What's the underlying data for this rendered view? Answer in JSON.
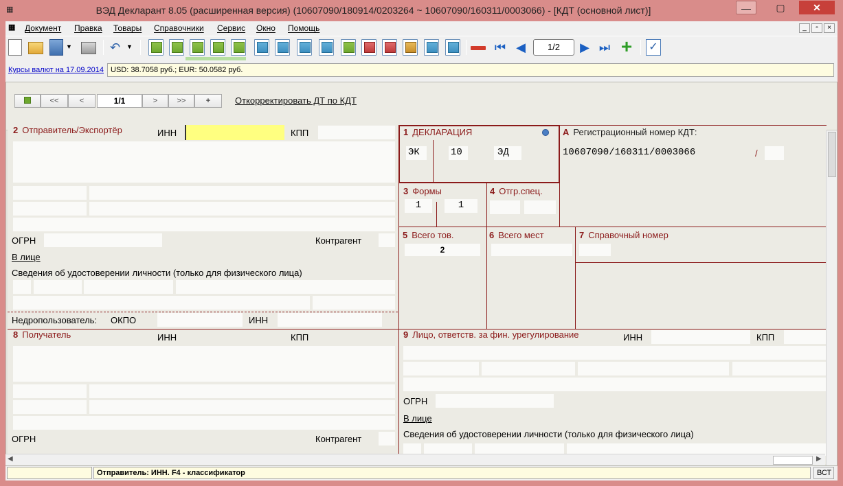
{
  "window": {
    "title": "ВЭД Декларант 8.05 (расширенная версия) (10607090/180914/0203264 ~ 10607090/160311/0003066) - [КДТ (основной лист)]",
    "min_label": "—",
    "max_label": "▢",
    "close_label": "✕"
  },
  "menu": {
    "items": [
      "Документ",
      "Правка",
      "Товары",
      "Справочники",
      "Сервис",
      "Окно",
      "Помощь"
    ],
    "mdi": [
      "_",
      "▫",
      "×"
    ]
  },
  "toolbar": {
    "pager": "1/2"
  },
  "rates": {
    "link": "Курсы валют на 17.09.2014",
    "text": "USD: 38.7058 руб.; EUR: 50.0582 руб."
  },
  "pagebar": {
    "first": "<<",
    "prev": "<",
    "page": "1/1",
    "next": ">",
    "last": ">>",
    "add": "+",
    "correct_link": "Откорректировать ДТ по КДТ"
  },
  "form": {
    "b2": {
      "num": "2",
      "title": "Отправитель/Экспортёр",
      "inn": "ИНН",
      "kpp": "КПП",
      "ogrn": "ОГРН",
      "kontragent": "Контрагент",
      "v_lice": "В лице",
      "svedeniya": "Сведения об удостоверении личности (только для физического лица)",
      "nedro": "Недропользователь:",
      "okpo": "ОКПО",
      "inn2": "ИНН"
    },
    "b1": {
      "num": "1",
      "title": "ДЕКЛАРАЦИЯ",
      "v1": "ЭК",
      "v2": "10",
      "v3": "ЭД"
    },
    "bA": {
      "num": "А",
      "title": "Регистрационный номер КДТ:",
      "value": "10607090/160311/0003066",
      "slash": "/"
    },
    "b3": {
      "num": "3",
      "title": "Формы",
      "v1": "1",
      "v2": "1"
    },
    "b4": {
      "num": "4",
      "title": "Отгр.спец."
    },
    "b5": {
      "num": "5",
      "title": "Всего тов.",
      "value": "2"
    },
    "b6": {
      "num": "6",
      "title": "Всего мест"
    },
    "b7": {
      "num": "7",
      "title": "Справочный номер"
    },
    "b8": {
      "num": "8",
      "title": "Получатель",
      "inn": "ИНН",
      "kpp": "КПП",
      "ogrn": "ОГРН",
      "kontragent": "Контрагент"
    },
    "b9": {
      "num": "9",
      "title": "Лицо, ответств. за фин. урегулирование",
      "inn": "ИНН",
      "kpp": "КПП",
      "ogrn": "ОГРН",
      "v_lice": "В лице",
      "svedeniya": "Сведения об удостоверении личности (только для физического лица)"
    }
  },
  "status": {
    "hint": "Отправитель: ИНН. F4 - классификатор",
    "mode": "ВСТ"
  }
}
